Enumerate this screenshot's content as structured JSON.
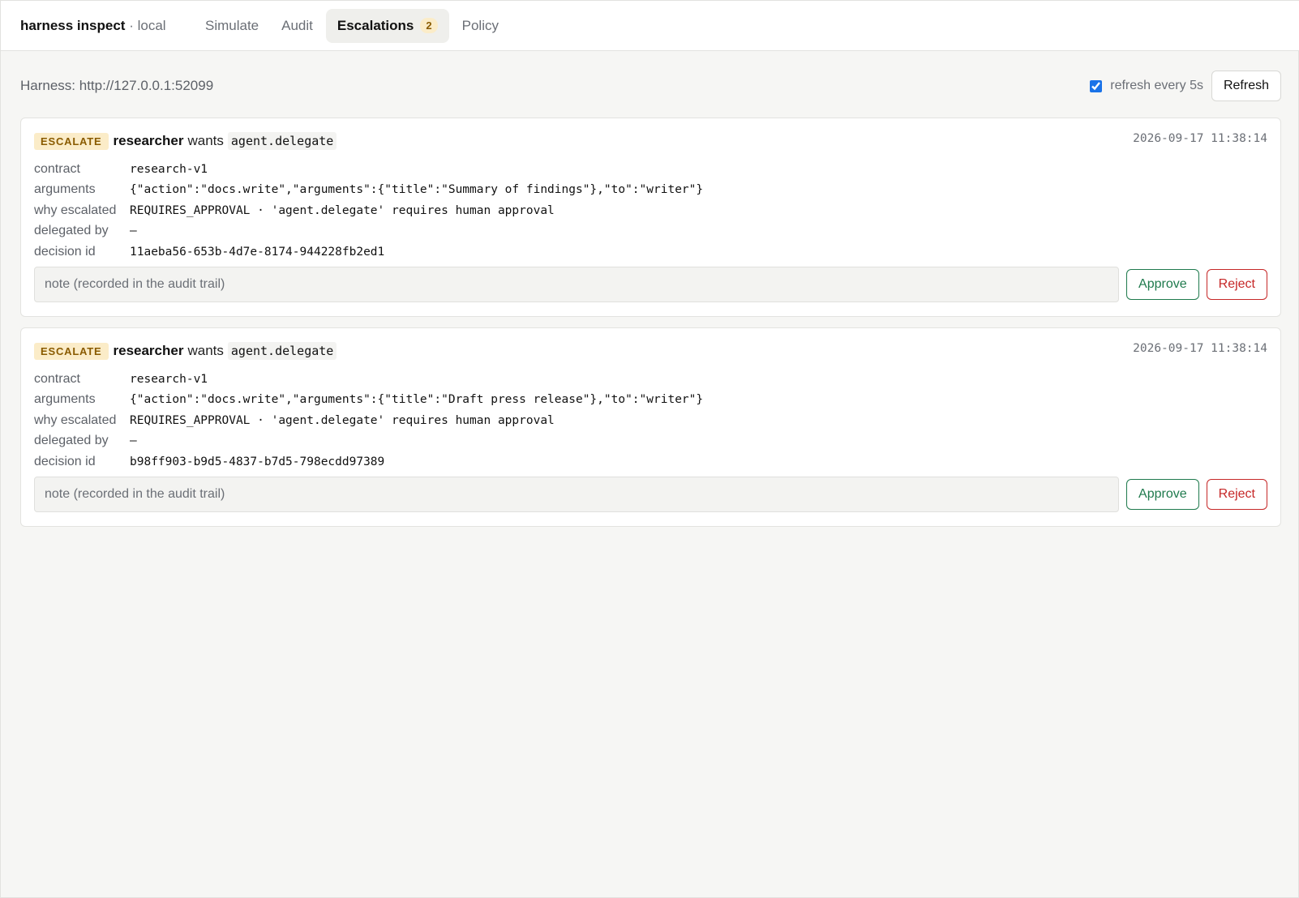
{
  "app": {
    "name": "harness inspect",
    "separator": "·",
    "env": "local"
  },
  "nav": {
    "tabs": [
      {
        "label": "Simulate",
        "active": false
      },
      {
        "label": "Audit",
        "active": false
      },
      {
        "label": "Escalations",
        "active": true,
        "badge": "2"
      },
      {
        "label": "Policy",
        "active": false
      }
    ]
  },
  "toolbar": {
    "harness_url": "Harness: http://127.0.0.1:52099",
    "auto_refresh_label": "refresh every 5s",
    "auto_refresh_checked": true,
    "refresh_label": "Refresh"
  },
  "field_labels": {
    "contract": "contract",
    "arguments": "arguments",
    "why": "why escalated",
    "delegated_by": "delegated by",
    "decision_id": "decision id"
  },
  "escalations": [
    {
      "verdict": "ESCALATE",
      "agent": "researcher",
      "wants": "wants",
      "tool": "agent.delegate",
      "timestamp": "2026-09-17 11:38:14",
      "contract": "research-v1",
      "arguments": "{\"action\":\"docs.write\",\"arguments\":{\"title\":\"Summary of findings\"},\"to\":\"writer\"}",
      "why": "REQUIRES_APPROVAL · 'agent.delegate' requires human approval",
      "delegated_by": "—",
      "decision_id": "11aeba56-653b-4d7e-8174-944228fb2ed1",
      "note_placeholder": "note (recorded in the audit trail)",
      "approve_label": "Approve",
      "reject_label": "Reject"
    },
    {
      "verdict": "ESCALATE",
      "agent": "researcher",
      "wants": "wants",
      "tool": "agent.delegate",
      "timestamp": "2026-09-17 11:38:14",
      "contract": "research-v1",
      "arguments": "{\"action\":\"docs.write\",\"arguments\":{\"title\":\"Draft press release\"},\"to\":\"writer\"}",
      "why": "REQUIRES_APPROVAL · 'agent.delegate' requires human approval",
      "delegated_by": "—",
      "decision_id": "b98ff903-b9d5-4837-b7d5-798ecdd97389",
      "note_placeholder": "note (recorded in the audit trail)",
      "approve_label": "Approve",
      "reject_label": "Reject"
    }
  ],
  "colors": {
    "accent": "#1a73e8",
    "escalate_bg": "#fbecc8",
    "escalate_fg": "#8a5b00",
    "approve": "#1f7a4d",
    "reject": "#c62828"
  }
}
